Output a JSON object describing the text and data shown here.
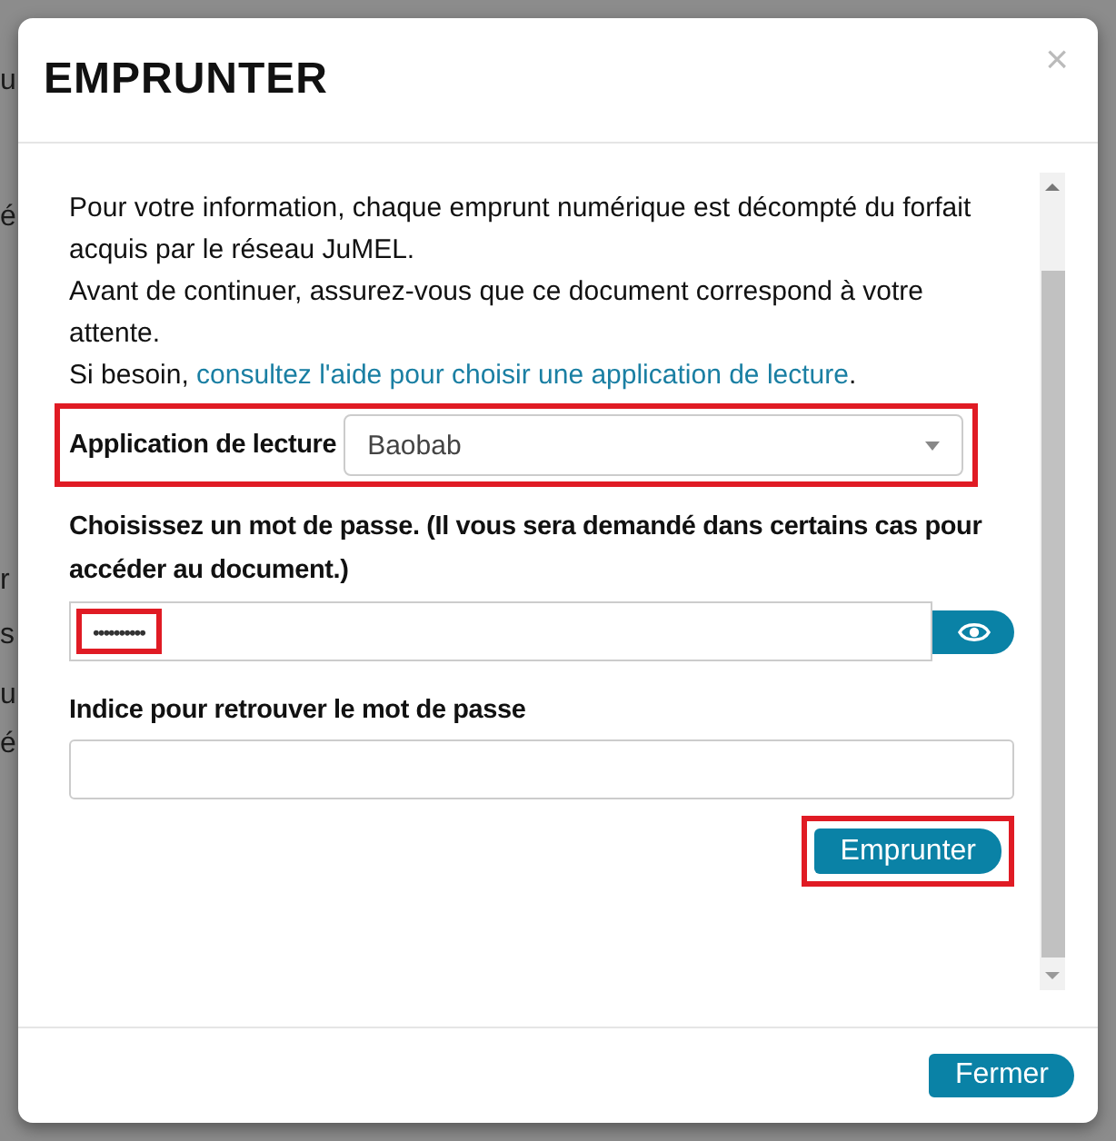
{
  "background": {
    "fragments": [
      "u",
      "é",
      "r",
      "s",
      "u",
      "é"
    ]
  },
  "dialog": {
    "title": "EMPRUNTER",
    "close": "×",
    "paragraphs": [
      {
        "text": "Pour votre information, chaque emprunt numérique est décompté du forfait acquis par le réseau JuMEL."
      },
      {
        "text": "Avant de continuer, assurez-vous que ce document correspond à votre attente."
      },
      {
        "text": "Si besoin, ",
        "link": "consultez l'aide pour choisir une application de lecture",
        "after": "."
      }
    ],
    "reader_app": {
      "label": "Application de lecture",
      "value": "Baobab",
      "highlighted": true
    },
    "password": {
      "label": "Choisissez un mot de passe. (Il vous sera demandé dans certains cas pour accéder au document.)",
      "value": "••••••••••",
      "highlighted": true
    },
    "hint": {
      "label": "Indice pour retrouver le mot de passe"
    },
    "borrow_button": {
      "label": "Emprunter",
      "highlighted": true
    },
    "close_button": {
      "label": "Fermer"
    }
  }
}
